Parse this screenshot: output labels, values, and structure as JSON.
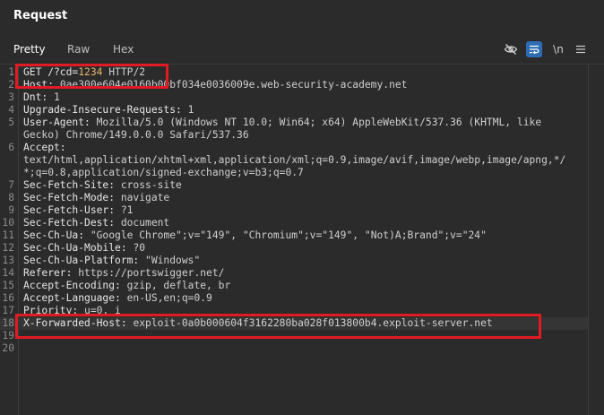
{
  "panel": {
    "title": "Request"
  },
  "tabs": [
    {
      "label": "Pretty",
      "active": true
    },
    {
      "label": "Raw",
      "active": false
    },
    {
      "label": "Hex",
      "active": false
    }
  ],
  "toolbar": {
    "hide_icon": "eye-slash-icon",
    "wrap_icon": "word-wrap-icon",
    "newline_label": "\\n",
    "menu_icon": "menu-icon"
  },
  "request": {
    "lines": [
      {
        "n": "1",
        "key": "GET /?cd=",
        "num": "1234",
        "val": " HTTP/2"
      },
      {
        "n": "2",
        "key": "Host: ",
        "val": "0ae300e604e0160b00bf034e0036009e.web-security-academy.net"
      },
      {
        "n": "3",
        "key": "Dnt: ",
        "val": "1"
      },
      {
        "n": "4",
        "key": "Upgrade-Insecure-Requests: ",
        "val": "1"
      },
      {
        "n": "5",
        "key": "User-Agent: ",
        "val": "Mozilla/5.0 (Windows NT 10.0; Win64; x64) AppleWebKit/537.36 (KHTML, like"
      },
      {
        "n": "",
        "key": "",
        "val": "Gecko) Chrome/149.0.0.0 Safari/537.36"
      },
      {
        "n": "6",
        "key": "Accept:",
        "val": ""
      },
      {
        "n": "",
        "key": "",
        "val": "text/html,application/xhtml+xml,application/xml;q=0.9,image/avif,image/webp,image/apng,*/"
      },
      {
        "n": "",
        "key": "",
        "val": "*;q=0.8,application/signed-exchange;v=b3;q=0.7"
      },
      {
        "n": "7",
        "key": "Sec-Fetch-Site: ",
        "val": "cross-site"
      },
      {
        "n": "8",
        "key": "Sec-Fetch-Mode: ",
        "val": "navigate"
      },
      {
        "n": "9",
        "key": "Sec-Fetch-User: ",
        "val": "?1"
      },
      {
        "n": "10",
        "key": "Sec-Fetch-Dest: ",
        "val": "document"
      },
      {
        "n": "11",
        "key": "Sec-Ch-Ua: ",
        "val": "\"Google Chrome\";v=\"149\", \"Chromium\";v=\"149\", \"Not)A;Brand\";v=\"24\""
      },
      {
        "n": "12",
        "key": "Sec-Ch-Ua-Mobile: ",
        "val": "?0"
      },
      {
        "n": "13",
        "key": "Sec-Ch-Ua-Platform: ",
        "val": "\"Windows\""
      },
      {
        "n": "14",
        "key": "Referer: ",
        "val": "https://portswigger.net/"
      },
      {
        "n": "15",
        "key": "Accept-Encoding: ",
        "val": "gzip, deflate, br"
      },
      {
        "n": "16",
        "key": "Accept-Language: ",
        "val": "en-US,en;q=0.9"
      },
      {
        "n": "17",
        "key": "Priority: ",
        "val": "u=0, i"
      },
      {
        "n": "18",
        "key": "X-Forwarded-Host: ",
        "val": "exploit-0a0b000604f3162280ba028f013800b4.exploit-server.net"
      },
      {
        "n": "19",
        "key": "",
        "val": ""
      },
      {
        "n": "20",
        "key": "",
        "val": ""
      }
    ]
  }
}
